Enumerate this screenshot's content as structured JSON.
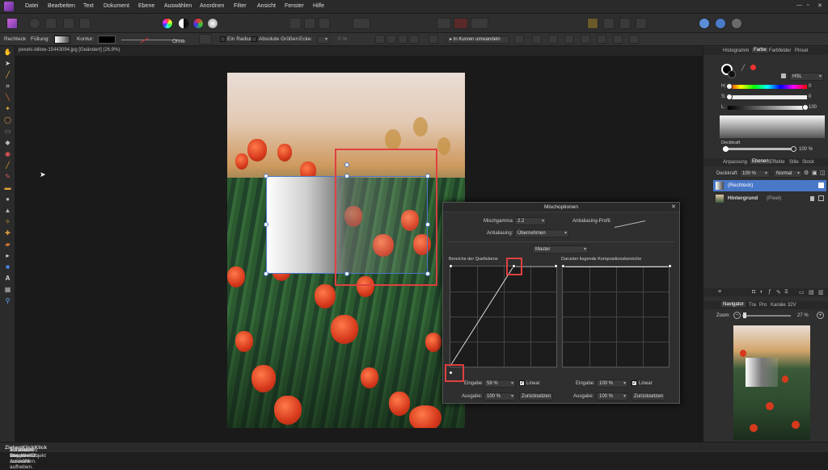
{
  "menu": [
    "Datei",
    "Bearbeiten",
    "Text",
    "Dokument",
    "Ebene",
    "Auswählen",
    "Anordnen",
    "Filter",
    "Ansicht",
    "Fenster",
    "Hilfe"
  ],
  "context_bar": {
    "tool": "Rechteck",
    "fill_label": "Füllung:",
    "stroke_label": "Kontur:",
    "stroke_none": "Ohne",
    "radius_label": "Ein Radius",
    "absolute_label": "Absolute Größen",
    "corner_label": "Ecke:",
    "corner_value": "0 %",
    "convert_label": "In Kurven umwandeln"
  },
  "document_tab": "pexels-billow-15443094.jpg [Geändert] (26,9%)",
  "status_parts": {
    "a": "'Rechteck' ausgewählt. ",
    "b": "Ziehen",
    "c": " = Auswahl verschieben. ",
    "d": "Klick",
    "e": " auf anderes Objekt = Objekt auswählen. ",
    "f": "Klick",
    "g": " auf leeren Bereich = Auswahl aufheben."
  },
  "right_panel": {
    "tabs_top": [
      "Histogramm",
      "Farbe",
      "Farbfelder",
      "Pinsel"
    ],
    "color_model": "HSL",
    "h_label": "H:",
    "h_value": "0",
    "s_label": "S:",
    "s_value": "0",
    "l_label": "L:",
    "l_value": "100",
    "opacity_label": "Deckkraft",
    "opacity_value": "100 %",
    "tabs_mid": [
      "Anpassung",
      "Ebenen",
      "Effekte",
      "Stile",
      "Stock"
    ],
    "layer_opacity_label": "Deckkraft:",
    "layer_opacity_value": "100 %",
    "blend_mode": "Normal",
    "layers": [
      {
        "name": "(Rechteck)",
        "kind": ""
      },
      {
        "name": "Hintergrund",
        "kind": "(Pixel)"
      }
    ],
    "tabs_bottom": [
      "Navigator",
      "Tra",
      "Pro",
      "Kanäle",
      "32V"
    ],
    "zoom_label": "Zoom:",
    "zoom_value": "27 %"
  },
  "dialog": {
    "title": "Mischoptionen",
    "gamma_label": "Mischgamma:",
    "gamma_value": "2.2",
    "aa_profile_label": "Antialiasing-Profil:",
    "aa_label": "Antialiasing:",
    "aa_value": "Übernehmen",
    "channel": "Master",
    "source_title": "Bereiche der Quellebene",
    "underlying_title": "Darunter liegende Kompositionsbereiche",
    "source": {
      "input_label": "Eingabe:",
      "input_value": "59 %",
      "linear_label": "Linear",
      "output_label": "Ausgabe:",
      "output_value": "100 %",
      "reset_label": "Zurücksetzen"
    },
    "underlying": {
      "input_label": "Eingabe:",
      "input_value": "100 %",
      "linear_label": "Linear",
      "output_label": "Ausgabe:",
      "output_value": "100 %",
      "reset_label": "Zurücksetzen"
    },
    "close_glyph": "✕"
  },
  "colors": {
    "accent": "#4a78c9",
    "highlight": "#e04040",
    "bg": "#1e1e1e"
  }
}
